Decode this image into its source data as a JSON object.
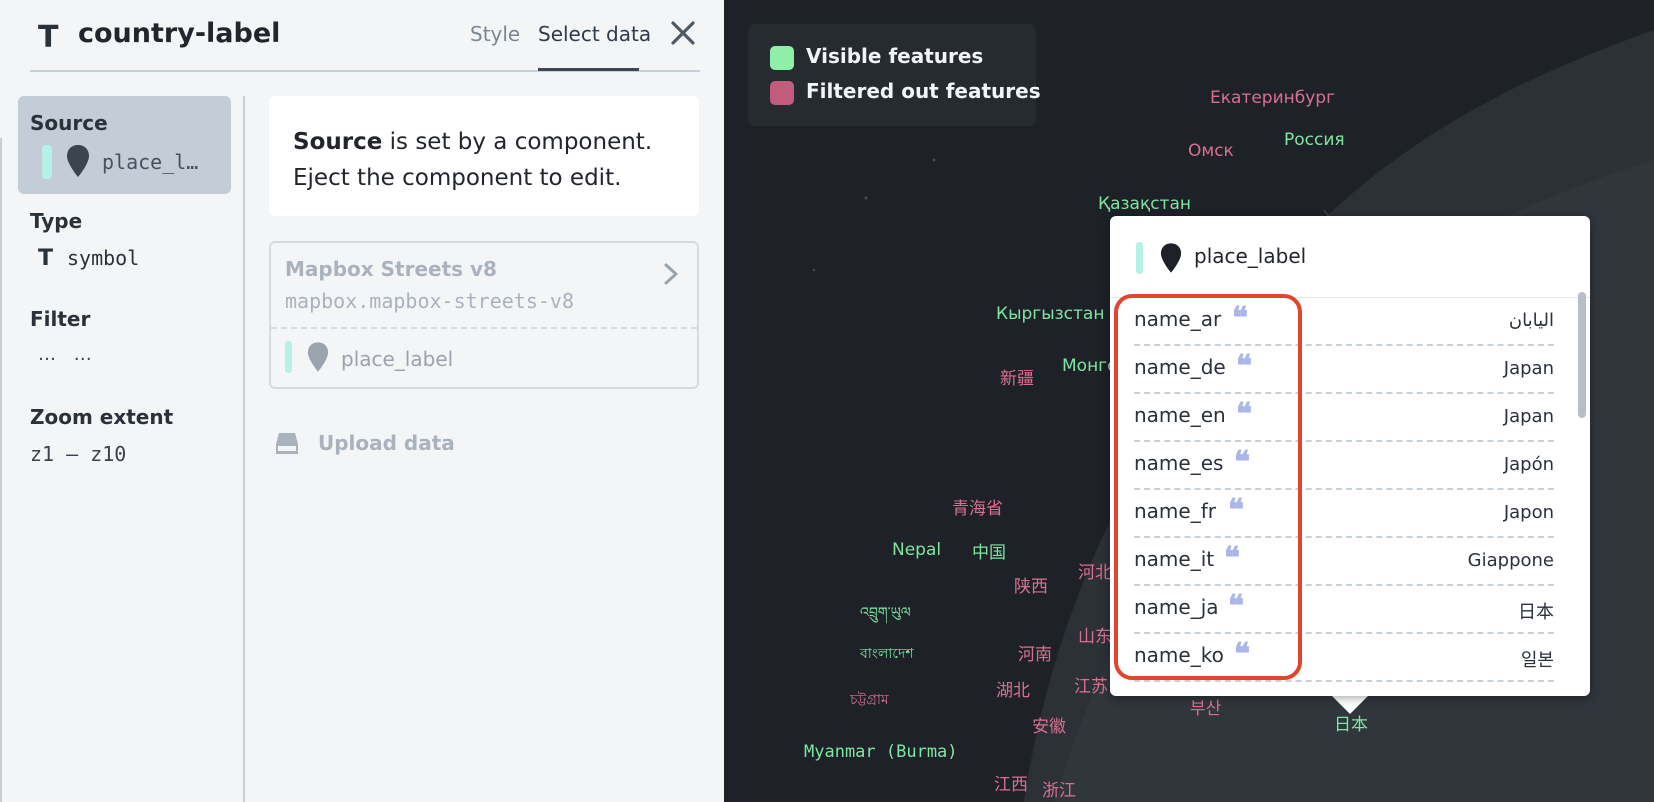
{
  "header": {
    "layer_icon": "T",
    "layer_name": "country-label",
    "tabs": [
      {
        "label": "Style",
        "active": false
      },
      {
        "label": "Select data",
        "active": true
      }
    ],
    "close_icon": "close-icon"
  },
  "source": {
    "label": "Source",
    "value": "place_l…",
    "icon": "map-pin-icon"
  },
  "type": {
    "label": "Type",
    "icon": "T",
    "value": "symbol"
  },
  "filter": {
    "label": "Filter",
    "value": "… …"
  },
  "zoom": {
    "label": "Zoom extent",
    "value": "z1 – z10"
  },
  "notice": {
    "bold": "Source",
    "text1": " is set by a component.",
    "text2": "Eject the component to edit."
  },
  "dataset": {
    "title": "Mapbox Streets v8",
    "id": "mapbox.mapbox-streets-v8",
    "layer": "place_label"
  },
  "upload": {
    "label": "Upload data",
    "icon": "storage-icon"
  },
  "legend": [
    {
      "label": "Visible features",
      "color": "#8ef0a6"
    },
    {
      "label": "Filtered out features",
      "color": "#c25c7c"
    }
  ],
  "map_labels": {
    "yekaterinburg": "Екатеринбург",
    "russia": "Россия",
    "omsk": "Омск",
    "kazakhstan": "Қазақстан",
    "kyrgyzstan": "Кыргызстан",
    "xinjiang": "新疆",
    "mongolia": "Монго",
    "qinghai": "青海省",
    "nepal": "Nepal",
    "china": "中国",
    "shaanxi": "陕西",
    "hebei": "河北",
    "bhutan": "འབྲུག་ཡུལ",
    "bangladesh": "বাংলাদেশ",
    "henan": "河南",
    "shandong": "山东",
    "chittagong": "চট্টগ্রাম",
    "hubei": "湖北",
    "jiangsu": "江苏",
    "busan": "부산",
    "japan": "日本",
    "anhui": "安徽",
    "myanmar": "Myanmar (Burma)",
    "jiangxi": "江西",
    "zhejiang": "浙江"
  },
  "popup": {
    "title": "place_label",
    "rows": [
      {
        "key": "name_ar",
        "value": "اليابان"
      },
      {
        "key": "name_de",
        "value": "Japan"
      },
      {
        "key": "name_en",
        "value": "Japan"
      },
      {
        "key": "name_es",
        "value": "Japón"
      },
      {
        "key": "name_fr",
        "value": "Japon"
      },
      {
        "key": "name_it",
        "value": "Giappone"
      },
      {
        "key": "name_ja",
        "value": "日本"
      },
      {
        "key": "name_ko",
        "value": "일본"
      }
    ],
    "quote_glyph": "❝"
  }
}
